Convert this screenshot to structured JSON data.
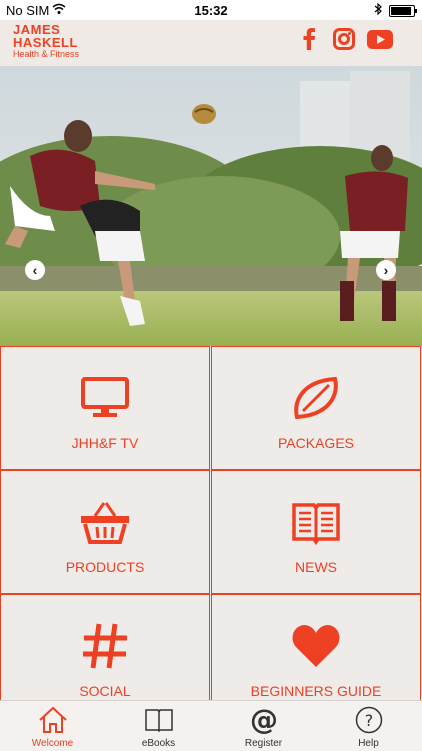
{
  "status_bar": {
    "carrier": "No SIM",
    "time": "15:32"
  },
  "header": {
    "logo_line1": "JAMES",
    "logo_line2": "HASKELL",
    "logo_line3": "Health & Fitness",
    "social": [
      "facebook-icon",
      "instagram-icon",
      "youtube-icon"
    ]
  },
  "hero": {
    "prev": "‹",
    "next": "›"
  },
  "tiles": [
    {
      "label": "JHH&F TV",
      "icon": "tv-icon"
    },
    {
      "label": "PACKAGES",
      "icon": "rugby-ball-icon"
    },
    {
      "label": "PRODUCTS",
      "icon": "basket-icon"
    },
    {
      "label": "NEWS",
      "icon": "book-icon"
    },
    {
      "label": "SOCIAL",
      "icon": "hashtag-icon"
    },
    {
      "label": "BEGINNERS GUIDE",
      "icon": "heart-icon"
    }
  ],
  "tabs": [
    {
      "label": "Welcome",
      "icon": "home-icon",
      "active": true
    },
    {
      "label": "eBooks",
      "icon": "book-icon"
    },
    {
      "label": "Register",
      "icon": "at-icon"
    },
    {
      "label": "Help",
      "icon": "help-icon"
    }
  ],
  "colors": {
    "accent": "#ee4123",
    "header_bg": "#efeae6",
    "tile_bg": "#efebe8"
  }
}
